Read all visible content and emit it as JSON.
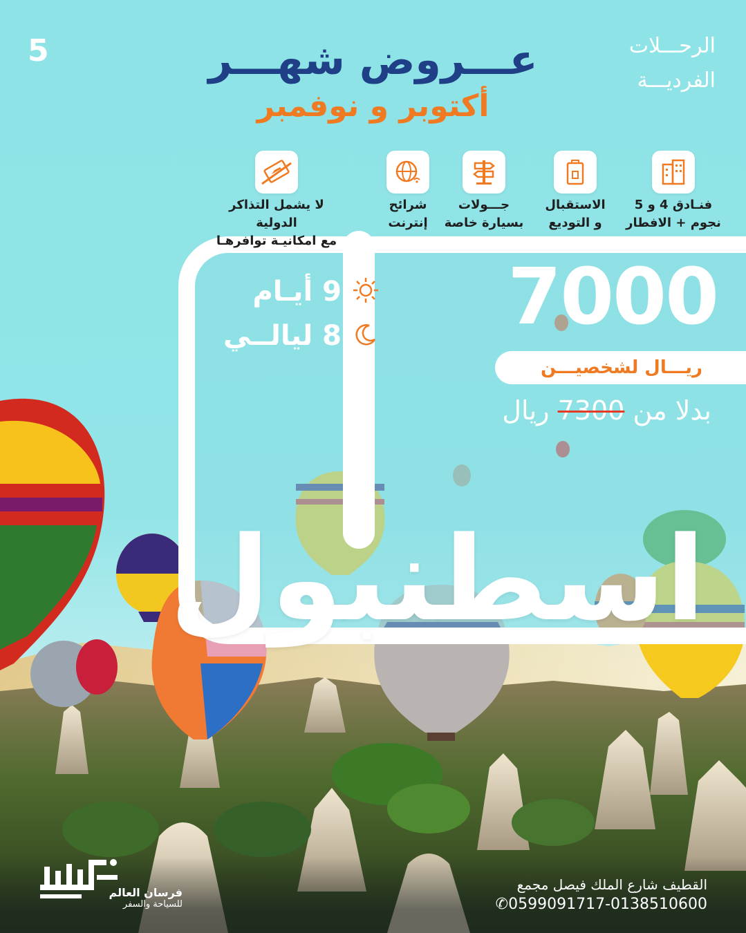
{
  "page_number": "5",
  "trip_type": [
    "الرحـــلات",
    "الفرديـــة"
  ],
  "title": {
    "main": "عـــروض شهـــر",
    "sub": "أكتوبر و نوفمبر"
  },
  "features": [
    {
      "icon": "hotel-building-icon",
      "label": [
        "فنـادق 4 و 5",
        "نجوم + الافطار"
      ]
    },
    {
      "icon": "luggage-icon",
      "label": [
        "الاستقبال",
        "و التوديع"
      ]
    },
    {
      "icon": "signpost-icon",
      "label": [
        "جـــولات",
        "بسيارة خاصة"
      ]
    },
    {
      "icon": "globe-wifi-icon",
      "label": [
        "شرائح",
        "إنترنت"
      ]
    },
    {
      "icon": "no-plane-ticket-icon",
      "label": [
        "لا يشمل التذاكر الدولية",
        "مع امكانيـة توافرهـا"
      ]
    }
  ],
  "duration": {
    "days": "9 أيـام",
    "nights": "8 ليالــي"
  },
  "price": {
    "amount": "7000",
    "unit": "ريـــال لشخصيـــن",
    "old_prefix": "بدلا من",
    "old_amount": "7300",
    "old_suffix": "ريال"
  },
  "destination": "اسطنبول",
  "contact": {
    "address": "القطيف شارع الملك فيصل مجمع",
    "phones": "0599091717-0138510600"
  },
  "brand": {
    "name": "فرسان العالم",
    "tagline": "للسياحة والسفر"
  },
  "colors": {
    "navy": "#1f3f86",
    "orange": "#ef7a22",
    "sky": "#8fe0e4",
    "strike": "#e23b26"
  }
}
